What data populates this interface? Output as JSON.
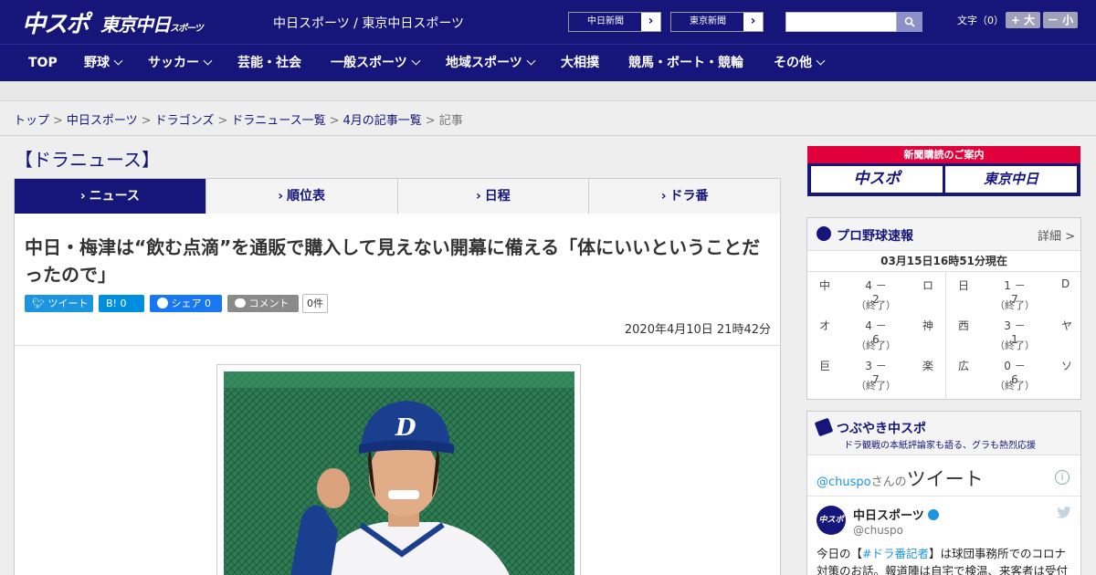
{
  "header": {
    "logo_main": "中スポ",
    "logo_tokyo": "東京中日",
    "logo_tokyo_suffix": "スポーツ",
    "subtitle": "中日スポーツ / 東京中日スポーツ",
    "ext_links": [
      {
        "label": "中日新聞",
        "arrow": "›"
      },
      {
        "label": "東京新聞",
        "arrow": "›"
      }
    ],
    "search": {
      "value": "",
      "placeholder": ""
    },
    "font_size_label": "文字（0）",
    "font_plus": "+ 大",
    "font_minus": "－ 小"
  },
  "nav": {
    "items": [
      {
        "label": "TOP"
      },
      {
        "label": "野球"
      },
      {
        "label": "サッカー"
      },
      {
        "label": "芸能・社会"
      },
      {
        "label": "一般スポーツ"
      },
      {
        "label": "地域スポーツ"
      },
      {
        "label": "大相撲"
      },
      {
        "label": "競馬・ボート・競輪"
      },
      {
        "label": "その他"
      }
    ]
  },
  "breadcrumb": {
    "items": [
      "トップ",
      "中日スポーツ",
      "ドラゴンズ",
      "ドラニュース一覧",
      "4月の記事一覧"
    ],
    "current": "記事",
    "sep": ">"
  },
  "section_title": "【ドラニュース】",
  "tabs": [
    {
      "label": "ニュース",
      "active": true
    },
    {
      "label": "順位表"
    },
    {
      "label": "日程"
    },
    {
      "label": "ドラ番"
    }
  ],
  "article": {
    "headline": "中日・梅津は“飲む点滴”を通販で購入して見えない開幕に備える「体にいいということだったので」",
    "share": {
      "tweet": "ツイート",
      "hatena": "B! 0",
      "facebook": "シェア 0",
      "comment": "コメント",
      "comment_count": "0件"
    },
    "published": "2020年4月10日 21時42分"
  },
  "sidebar": {
    "promo": {
      "top": "新聞購読のご案内",
      "left": "中スポ",
      "right": "東京中日"
    },
    "scores": {
      "title": "プロ野球速報",
      "more": "詳細 >",
      "as_of": "03月15日16時51分現在",
      "left": [
        {
          "t1": "中",
          "score": "4 － 2",
          "t2": "ロ",
          "status": "（終了）"
        },
        {
          "t1": "オ",
          "score": "4 － 6",
          "t2": "神",
          "status": "（終了）"
        },
        {
          "t1": "巨",
          "score": "3 － 7",
          "t2": "楽",
          "status": "（終了）"
        }
      ],
      "right": [
        {
          "t1": "日",
          "score": "1 － 7",
          "t2": "D",
          "status": "（終了）"
        },
        {
          "t1": "西",
          "score": "3 － 1",
          "t2": "ヤ",
          "status": "（終了）"
        },
        {
          "t1": "広",
          "score": "0 － 6",
          "t2": "ソ",
          "status": "（終了）"
        }
      ]
    },
    "tweets": {
      "title": "つぶやき中スポ",
      "subtitle": "ドラ観戦の本紙評論家も語る、グラも熱烈応援",
      "handle_prefix": "@chuspo",
      "handle_suffix": "さんの",
      "tweet_label": "ツイート",
      "account_name": "中日スポーツ",
      "account_handle": "@chuspo",
      "avatar_text": "中スポ",
      "text_before": "今日の【",
      "text_tag": "#ドラ番記者",
      "text_after": "】は球団事務所でのコロナ対策のお話。報道陣は自宅で検温、来客者は受付で検"
    }
  },
  "colors": {
    "brand_navy": "#15157a",
    "promo_red": "#e0003c",
    "twitter_blue": "#1b95e0"
  }
}
